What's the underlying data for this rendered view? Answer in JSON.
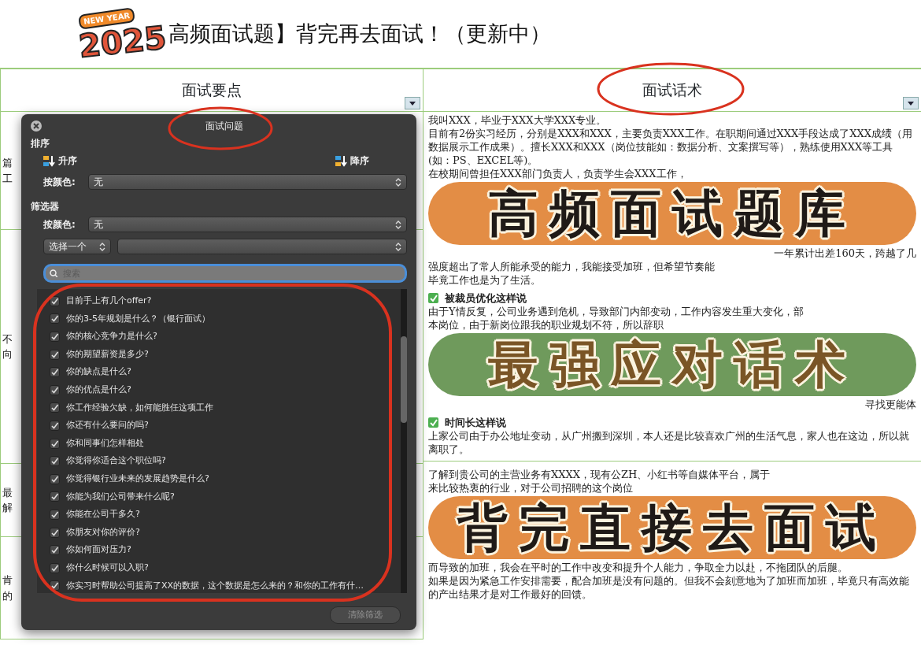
{
  "title": {
    "badge_top": "NEW YEAR",
    "badge_year": "2025",
    "text": "高频面试题】背完再去面试！（更新中）"
  },
  "sheet": {
    "columns": [
      "面试要点",
      "面试话术"
    ],
    "left_rows": [
      {
        "lines": [
          "篇",
          "工"
        ]
      },
      {
        "lines": [
          "不",
          "向"
        ]
      },
      {
        "lines": [
          "最",
          "解"
        ]
      },
      {
        "lines": [
          "肯",
          "的"
        ]
      }
    ],
    "right_blocks": [
      {
        "kind": "text",
        "text": "我叫XXX，毕业于XXX大学XXX专业。"
      },
      {
        "kind": "text",
        "text": "目前有2份实习经历，分别是XXX和XXX，主要负责XXX工作。在职期间通过XXX手段达成了XXX成绩（用数据展示工作成果）。擅长XXX和XXX（岗位技能如：数据分析、文案撰写等），熟练使用XXX等工具(如：PS、EXCEL等)。"
      },
      {
        "kind": "text",
        "text": "在校期间曾担任XXX部门负责人，负责学生会XXX工作，"
      },
      {
        "kind": "sticker",
        "text": "高频面试题库",
        "color": "#e38d45"
      },
      {
        "kind": "fragment",
        "text": "一年累计出差160天，跨越了几"
      },
      {
        "kind": "text",
        "text": "强度超出了常人所能承受的能力，我能接受加班，但希望节奏能"
      },
      {
        "kind": "text",
        "text": "毕竟工作也是为了生活。"
      },
      {
        "kind": "heading",
        "text": "被裁员优化这样说"
      },
      {
        "kind": "text",
        "text": "由于Y情反复，公司业务遇到危机，导致部门内部变动，工作内容发生重大变化，部"
      },
      {
        "kind": "text",
        "text": "本岗位，由于新岗位跟我的职业规划不符，所以辞职"
      },
      {
        "kind": "sticker_alt",
        "text": "最强应对话术",
        "color": "#6f9a5c"
      },
      {
        "kind": "fragment",
        "text": "寻找更能体"
      },
      {
        "kind": "heading",
        "text": "时间长这样说"
      },
      {
        "kind": "text",
        "text": "上家公司由于办公地址变动，从广州搬到深圳，本人还是比较喜欢广州的生活气息，家人也在这边，所以就离职了。"
      },
      {
        "kind": "divider"
      },
      {
        "kind": "text",
        "text": "了解到贵公司的主营业务有XXXX，现有公ZH、小红书等自媒体平台，属于"
      },
      {
        "kind": "text",
        "text": "来比较热衷的行业，对于公司招聘的这个岗位"
      },
      {
        "kind": "sticker",
        "text": "背完直接去面试",
        "color": "#e38d45"
      },
      {
        "kind": "text",
        "text": "而导致的加班，我会在平时的工作中改变和提升个人能力，争取全力以赴，不拖团队的后腿。"
      },
      {
        "kind": "text",
        "text": "如果是因为紧急工作安排需要，配合加班是没有问题的。但我不会刻意地为了加班而加班，毕竟只有高效能的产出结果才是对工作最好的回馈。"
      }
    ]
  },
  "filter_popup": {
    "title": "面试问题",
    "sort_label": "排序",
    "sort_buttons": [
      "升序",
      "降序"
    ],
    "sort_color_label": "按颜色:",
    "sort_color_value": "无",
    "filter_label": "筛选器",
    "filter_color_label": "按颜色:",
    "filter_color_value": "无",
    "condition": "选择一个",
    "search_placeholder": "搜索",
    "items": [
      {
        "label": "目前手上有几个offer?",
        "checked": true
      },
      {
        "label": "你的3-5年规划是什么？（银行面试）",
        "checked": true
      },
      {
        "label": "你的核心竞争力是什么?",
        "checked": true
      },
      {
        "label": "你的期望薪资是多少?",
        "checked": true
      },
      {
        "label": "你的缺点是什么?",
        "checked": true
      },
      {
        "label": "你的优点是什么?",
        "checked": true
      },
      {
        "label": "你工作经验欠缺，如何能胜任这项工作",
        "checked": true
      },
      {
        "label": "你还有什么要问的吗?",
        "checked": true
      },
      {
        "label": "你和同事们怎样相处",
        "checked": true
      },
      {
        "label": "你觉得你适合这个职位吗?",
        "checked": true
      },
      {
        "label": "你觉得银行业未来的发展趋势是什么?",
        "checked": true
      },
      {
        "label": "你能为我们公司带来什么呢?",
        "checked": true
      },
      {
        "label": "你能在公司干多久?",
        "checked": true
      },
      {
        "label": "你朋友对你的评价?",
        "checked": true
      },
      {
        "label": "你如何面对压力?",
        "checked": true
      },
      {
        "label": "你什么时候可以入职?",
        "checked": true
      },
      {
        "label": "你实习时帮助公司提高了XX的数据，这个数据是怎么来的？和你的工作有什…",
        "checked": true
      }
    ],
    "clear_button": "清除筛选"
  }
}
